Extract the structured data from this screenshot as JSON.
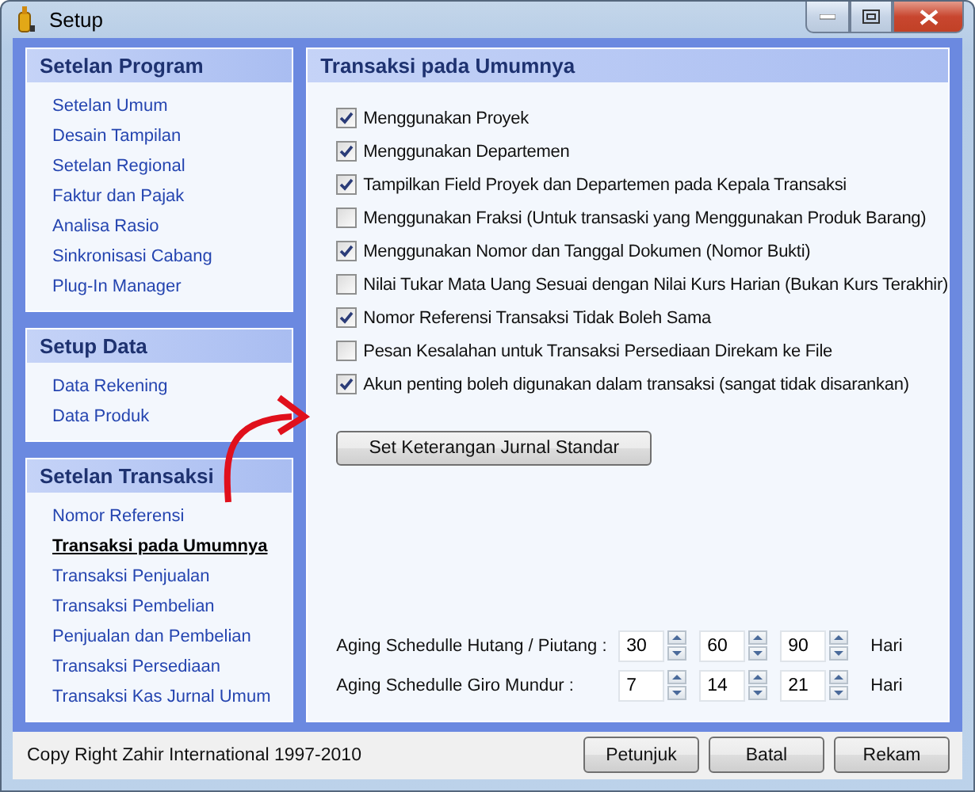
{
  "window": {
    "title": "Setup"
  },
  "sidebar": [
    {
      "title": "Setelan Program",
      "items": [
        {
          "label": "Setelan Umum",
          "selected": false
        },
        {
          "label": "Desain Tampilan",
          "selected": false
        },
        {
          "label": "Setelan Regional",
          "selected": false
        },
        {
          "label": "Faktur dan Pajak",
          "selected": false
        },
        {
          "label": "Analisa Rasio",
          "selected": false
        },
        {
          "label": "Sinkronisasi Cabang",
          "selected": false
        },
        {
          "label": "Plug-In Manager",
          "selected": false
        }
      ]
    },
    {
      "title": "Setup Data",
      "items": [
        {
          "label": "Data Rekening",
          "selected": false
        },
        {
          "label": "Data Produk",
          "selected": false
        }
      ]
    },
    {
      "title": "Setelan Transaksi",
      "items": [
        {
          "label": "Nomor Referensi",
          "selected": false
        },
        {
          "label": "Transaksi pada Umumnya",
          "selected": true
        },
        {
          "label": "Transaksi Penjualan",
          "selected": false
        },
        {
          "label": "Transaksi Pembelian",
          "selected": false
        },
        {
          "label": "Penjualan dan Pembelian",
          "selected": false
        },
        {
          "label": "Transaksi Persediaan",
          "selected": false
        },
        {
          "label": "Transaksi Kas Jurnal Umum",
          "selected": false
        }
      ]
    }
  ],
  "panel": {
    "title": "Transaksi pada Umumnya",
    "options": [
      {
        "label": "Menggunakan Proyek",
        "checked": true
      },
      {
        "label": "Menggunakan Departemen",
        "checked": true
      },
      {
        "label": "Tampilkan Field Proyek dan Departemen pada Kepala Transaksi",
        "checked": true
      },
      {
        "label": "Menggunakan Fraksi (Untuk transaski yang Menggunakan Produk Barang)",
        "checked": false
      },
      {
        "label": "Menggunakan Nomor dan Tanggal Dokumen (Nomor Bukti)",
        "checked": true
      },
      {
        "label": "Nilai Tukar Mata Uang Sesuai dengan Nilai Kurs Harian (Bukan Kurs Terakhir)",
        "checked": false
      },
      {
        "label": "Nomor Referensi Transaksi Tidak Boleh Sama",
        "checked": true
      },
      {
        "label": "Pesan Kesalahan untuk Transaksi Persediaan Direkam ke File",
        "checked": false
      },
      {
        "label": "Akun penting boleh digunakan dalam transaksi (sangat tidak disarankan)",
        "checked": true
      }
    ],
    "button": "Set Keterangan Jurnal Standar",
    "aging": [
      {
        "label": "Aging Schedulle Hutang / Piutang  :",
        "values": [
          "30",
          "60",
          "90"
        ],
        "unit": "Hari"
      },
      {
        "label": "Aging Schedulle Giro Mundur :",
        "values": [
          "7",
          "14",
          "21"
        ],
        "unit": "Hari"
      }
    ]
  },
  "footer": {
    "copyright": "Copy Right Zahir International 1997-2010",
    "buttons": [
      "Petunjuk",
      "Batal",
      "Rekam"
    ]
  }
}
